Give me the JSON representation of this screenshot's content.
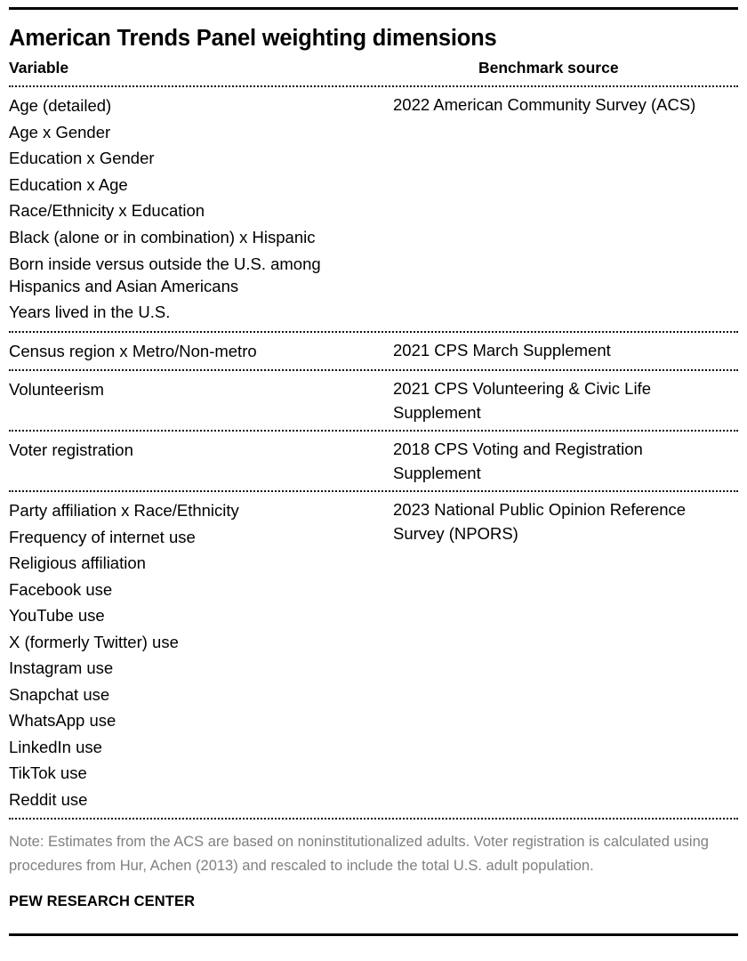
{
  "header": {
    "title": "American Trends Panel weighting dimensions",
    "column_variable": "Variable",
    "column_source": "Benchmark source"
  },
  "groups": [
    {
      "variables": [
        "Age (detailed)",
        "Age x Gender",
        "Education x Gender",
        "Education x Age",
        "Race/Ethnicity x Education",
        "Black (alone or in combination) x Hispanic",
        "Born inside versus outside the U.S. among\nHispanics and Asian Americans",
        "Years lived in the U.S."
      ],
      "source": "2022 American Community Survey (ACS)"
    },
    {
      "variables": [
        "Census region x Metro/Non-metro"
      ],
      "source": "2021 CPS March Supplement"
    },
    {
      "variables": [
        "Volunteerism"
      ],
      "source": "2021 CPS Volunteering & Civic Life Supplement"
    },
    {
      "variables": [
        "Voter registration"
      ],
      "source": "2018 CPS Voting and Registration Supplement"
    },
    {
      "variables": [
        "Party affiliation x Race/Ethnicity",
        "Frequency of internet use",
        "Religious affiliation",
        "Facebook use",
        "YouTube use",
        "X (formerly Twitter) use",
        "Instagram use",
        "Snapchat use",
        "WhatsApp use",
        "LinkedIn use",
        "TikTok use",
        "Reddit use"
      ],
      "source": "2023 National Public Opinion Reference Survey (NPORS)"
    }
  ],
  "footer": {
    "note": "Note: Estimates from the ACS are based on noninstitutionalized adults. Voter registration is calculated using procedures from Hur, Achen (2013) and rescaled to include the total U.S. adult population.",
    "brand": "PEW RESEARCH CENTER"
  },
  "colors": {
    "text": "#000000",
    "note_text": "#808080",
    "rule": "#000000",
    "background": "#ffffff"
  }
}
